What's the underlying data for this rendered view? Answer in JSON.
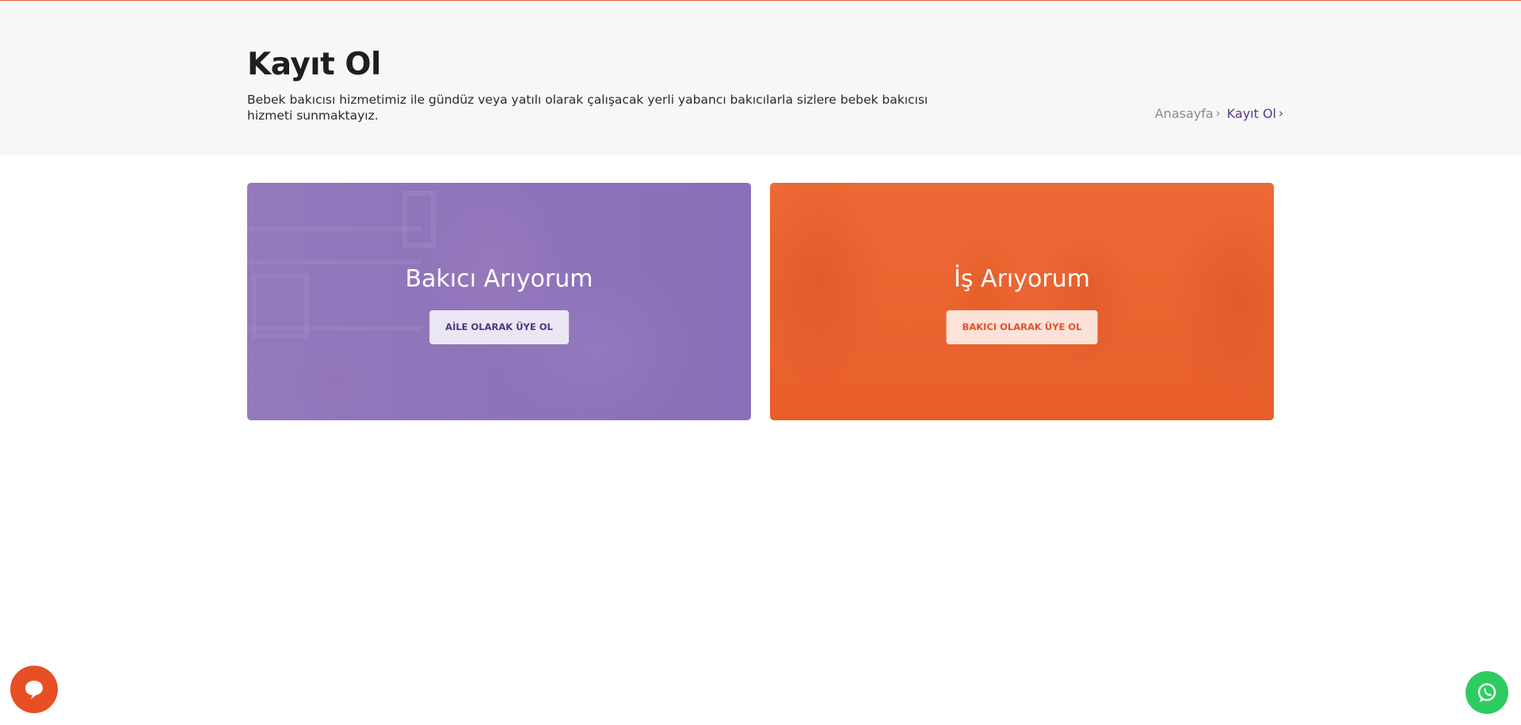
{
  "header": {
    "title": "Kayıt Ol",
    "description": "Bebek bakıcısı hizmetimiz ile gündüz veya yatılı olarak çalışacak yerli yabancı bakıcılarla sizlere bebek bakıcısı hizmeti sunmaktayız."
  },
  "breadcrumb": {
    "home": "Anasayfa",
    "current": "Kayıt Ol"
  },
  "cards": [
    {
      "title": "Bakıcı Arıyorum",
      "button": "AİLE OLARAK ÜYE OL",
      "overlay_color": "#7858ac"
    },
    {
      "title": "İş Arıyorum",
      "button": "BAKICI OLARAK ÜYE OL",
      "overlay_color": "#ea5c28"
    }
  ],
  "colors": {
    "accent_purple": "#5a3b8a",
    "accent_orange": "#e84e23",
    "whatsapp_green": "#2ecc60",
    "header_bg": "#f7f7f7"
  },
  "icons": {
    "chat": "chat-bubble-icon",
    "whatsapp": "whatsapp-icon",
    "breadcrumb_separator": "chevron-right-icon"
  }
}
